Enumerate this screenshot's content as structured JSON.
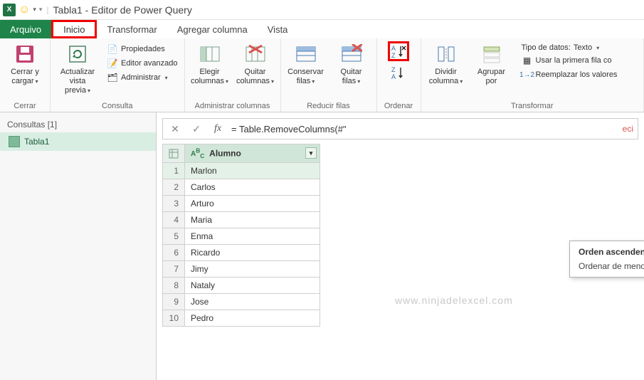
{
  "title": "Tabla1 - Editor de Power Query",
  "tabs": {
    "file": "Arquivo",
    "home": "Inicio",
    "transform": "Transformar",
    "addcol": "Agregar columna",
    "view": "Vista"
  },
  "ribbon": {
    "close": {
      "label": "Cerrar y cargar",
      "group": "Cerrar"
    },
    "refresh": {
      "label": "Actualizar vista previa",
      "props": "Propiedades",
      "adv": "Editor avanzado",
      "admin": "Administrar",
      "group": "Consulta"
    },
    "cols": {
      "choose": "Elegir columnas",
      "remove": "Quitar columnas",
      "group": "Administrar columnas"
    },
    "rows": {
      "keep": "Conservar filas",
      "remove": "Quitar filas",
      "group": "Reducir filas"
    },
    "sort": {
      "group": "Ordenar"
    },
    "split": {
      "split": "Dividir columna",
      "groupby": "Agrupar por",
      "dtype_label": "Tipo de datos:",
      "dtype_value": "Texto",
      "firstrow": "Usar la primera fila co",
      "replace": "Reemplazar los valores",
      "group": "Transformar"
    }
  },
  "tooltip": {
    "title": "Orden ascendente",
    "desc": "Ordenar de menor a mayor."
  },
  "sidebar": {
    "header": "Consultas [1]",
    "item": "Tabla1"
  },
  "formula": "= Table.RemoveColumns(#\"",
  "column": "Alumno",
  "data": [
    "Marlon",
    "Carlos",
    "Arturo",
    "Maria",
    "Enma",
    "Ricardo",
    "Jimy",
    "Nataly",
    "Jose",
    "Pedro"
  ],
  "watermark": "www.ninjadelexcel.com",
  "fx_cut": "eci"
}
